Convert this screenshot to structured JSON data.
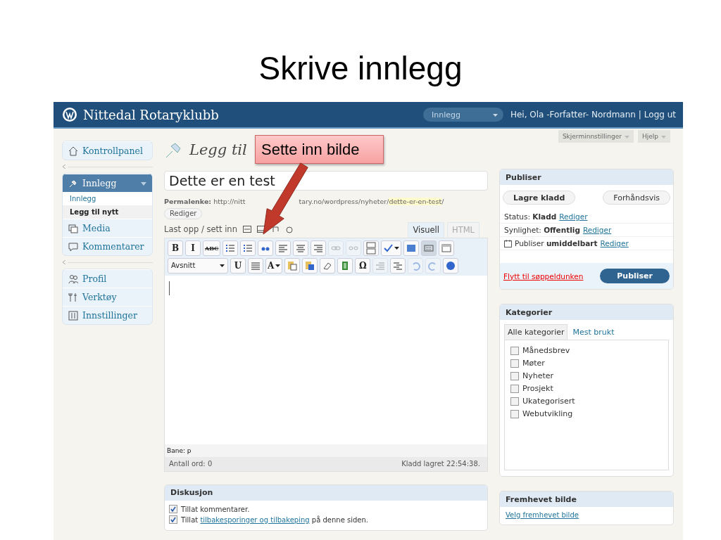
{
  "slide_title": "Skrive innlegg",
  "header": {
    "site_name": "Nittedal Rotaryklubb",
    "dropdown": "Innlegg",
    "greeting": "Hei, Ola -Forfatter- Nordmann",
    "separator": "|",
    "logout": "Logg ut"
  },
  "screen_tabs": [
    "Skjerminnstillinger",
    "Hjelp"
  ],
  "sidebar": {
    "groups": [
      [
        {
          "label": "Kontrollpanel",
          "selected": false
        }
      ],
      [
        {
          "label": "Innlegg",
          "selected": true,
          "children": [
            {
              "label": "Innlegg",
              "selected": false
            },
            {
              "label": "Legg til nytt",
              "selected": true
            }
          ]
        },
        {
          "label": "Media",
          "selected": false
        },
        {
          "label": "Kommentarer",
          "selected": false
        }
      ],
      [
        {
          "label": "Profil",
          "selected": false
        },
        {
          "label": "Verktøy",
          "selected": false
        },
        {
          "label": "Innstillinger",
          "selected": false
        }
      ]
    ]
  },
  "page_heading": "Legg til",
  "callout": "Sette inn bilde",
  "post_title": "Dette er en test",
  "permalink": {
    "label": "Permalenke:",
    "url_start": "http://nitt",
    "url_end": "tary.no/wordpress/nyheter/",
    "slug": "dette-er-en-test",
    "trail": "/",
    "edit": "Rediger"
  },
  "upload_label": "Last opp / sett inn",
  "editor_tabs": [
    {
      "label": "Visuell",
      "selected": true
    },
    {
      "label": "HTML",
      "selected": false
    }
  ],
  "toolbar": [
    [
      {
        "kind": "button",
        "label": "B",
        "disabled": false,
        "pressed": false
      },
      {
        "kind": "button",
        "label": "I",
        "disabled": false,
        "pressed": false
      },
      {
        "kind": "button",
        "label": "ABC",
        "disabled": false,
        "pressed": false
      },
      {
        "kind": "button",
        "disabled": false,
        "pressed": false
      },
      {
        "kind": "button",
        "disabled": false,
        "pressed": false
      },
      {
        "kind": "button",
        "disabled": false,
        "pressed": false
      },
      {
        "kind": "button",
        "disabled": false,
        "pressed": false
      },
      {
        "kind": "button",
        "disabled": false,
        "pressed": false
      },
      {
        "kind": "button",
        "disabled": false,
        "pressed": false
      },
      {
        "kind": "button",
        "disabled": true,
        "pressed": false
      },
      {
        "kind": "button",
        "disabled": true,
        "pressed": false
      },
      {
        "kind": "button",
        "disabled": false,
        "pressed": false
      },
      {
        "kind": "split",
        "disabled": false,
        "pressed": false
      },
      {
        "kind": "button",
        "disabled": false,
        "pressed": false
      },
      {
        "kind": "button",
        "disabled": false,
        "pressed": true
      },
      {
        "kind": "button",
        "disabled": false,
        "pressed": false
      }
    ],
    [
      {
        "kind": "select",
        "label": "Avsnitt",
        "disabled": false
      },
      {
        "kind": "button",
        "label": "U",
        "disabled": false,
        "pressed": false
      },
      {
        "kind": "button",
        "disabled": false,
        "pressed": false
      },
      {
        "kind": "split",
        "label": "A",
        "disabled": false,
        "pressed": false
      },
      {
        "kind": "button",
        "disabled": false,
        "pressed": false
      },
      {
        "kind": "button",
        "disabled": false,
        "pressed": false
      },
      {
        "kind": "button",
        "disabled": false,
        "pressed": false
      },
      {
        "kind": "button",
        "disabled": false,
        "pressed": false
      },
      {
        "kind": "button",
        "label": "Ω",
        "disabled": false,
        "pressed": false
      },
      {
        "kind": "button",
        "disabled": true,
        "pressed": false
      },
      {
        "kind": "button",
        "disabled": false,
        "pressed": false
      },
      {
        "kind": "button",
        "disabled": true,
        "pressed": false
      },
      {
        "kind": "button",
        "disabled": true,
        "pressed": false
      },
      {
        "kind": "button",
        "disabled": false,
        "pressed": false
      }
    ]
  ],
  "path_label": "Bane: p",
  "word_count": "Antall ord: 0",
  "draft_saved": "Kladd lagret 22:54:38.",
  "discussion": {
    "title": "Diskusjon",
    "options": [
      {
        "text": "Tillat kommentarer.",
        "checked": true
      },
      {
        "text": "Tillat",
        "link": "tilbakesporinger og tilbakeping",
        "text_after": "på denne siden.",
        "checked": true
      }
    ]
  },
  "publish": {
    "title": "Publiser",
    "save_draft": "Lagre kladd",
    "preview": "Forhåndsvis",
    "rows": [
      {
        "text": "Status: **Kladd**",
        "edit": "Rediger"
      },
      {
        "text": "Synlighet: **Offentlig**",
        "edit": "Rediger"
      },
      {
        "text": "Publiser **umiddelbart**",
        "edit": "Rediger"
      }
    ],
    "trash": "Flytt til søppeldunken",
    "submit": "Publiser"
  },
  "categories": {
    "title": "Kategorier",
    "tabs": [
      {
        "label": "Alle kategorier",
        "selected": true
      },
      {
        "label": "Mest brukt",
        "selected": false
      }
    ],
    "items": [
      {
        "label": "Månedsbrev",
        "checked": false
      },
      {
        "label": "Møter",
        "checked": false
      },
      {
        "label": "Nyheter",
        "checked": false
      },
      {
        "label": "Prosjekt",
        "checked": false
      },
      {
        "label": "Ukategorisert",
        "checked": false
      },
      {
        "label": "Webutvikling",
        "checked": false
      }
    ]
  },
  "featured_image": {
    "title": "Fremhevet bilde",
    "link": "Velg fremhevet bilde"
  }
}
